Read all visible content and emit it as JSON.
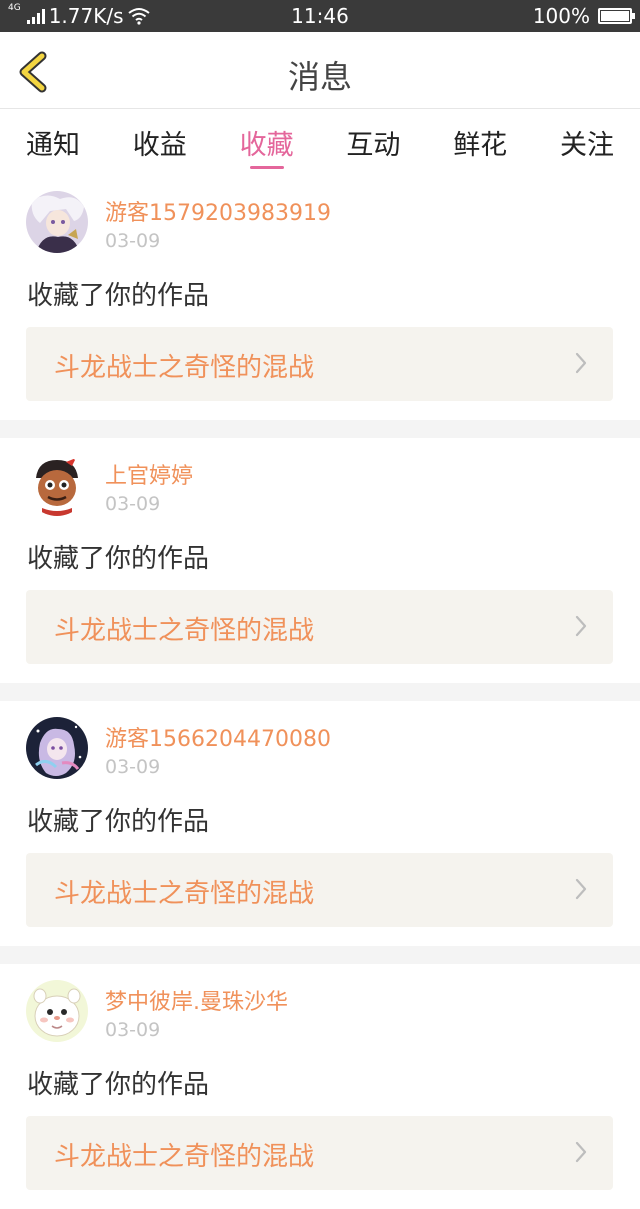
{
  "status_bar": {
    "network_tag": "4G",
    "speed": "1.77K/s",
    "time": "11:46",
    "battery": "100%",
    "battery_level": 1.0
  },
  "header": {
    "title": "消息"
  },
  "tabs": [
    {
      "label": "通知",
      "active": false
    },
    {
      "label": "收益",
      "active": false
    },
    {
      "label": "收藏",
      "active": true
    },
    {
      "label": "互动",
      "active": false
    },
    {
      "label": "鲜花",
      "active": false
    },
    {
      "label": "关注",
      "active": false
    }
  ],
  "feed": [
    {
      "user": "游客1579203983919",
      "date": "03-09",
      "action": "收藏了你的作品",
      "work": "斗龙战士之奇怪的混战"
    },
    {
      "user": "上官婷婷",
      "date": "03-09",
      "action": "收藏了你的作品",
      "work": "斗龙战士之奇怪的混战"
    },
    {
      "user": "游客1566204470080",
      "date": "03-09",
      "action": "收藏了你的作品",
      "work": "斗龙战士之奇怪的混战"
    },
    {
      "user": "梦中彼岸.曼珠沙华",
      "date": "03-09",
      "action": "收藏了你的作品",
      "work": "斗龙战士之奇怪的混战"
    }
  ],
  "colors": {
    "accent": "#e4669b",
    "name": "#f0915a",
    "date": "#c4c4c4",
    "card_bg": "#f5f3ee",
    "back_arrow": "#f3d541"
  }
}
